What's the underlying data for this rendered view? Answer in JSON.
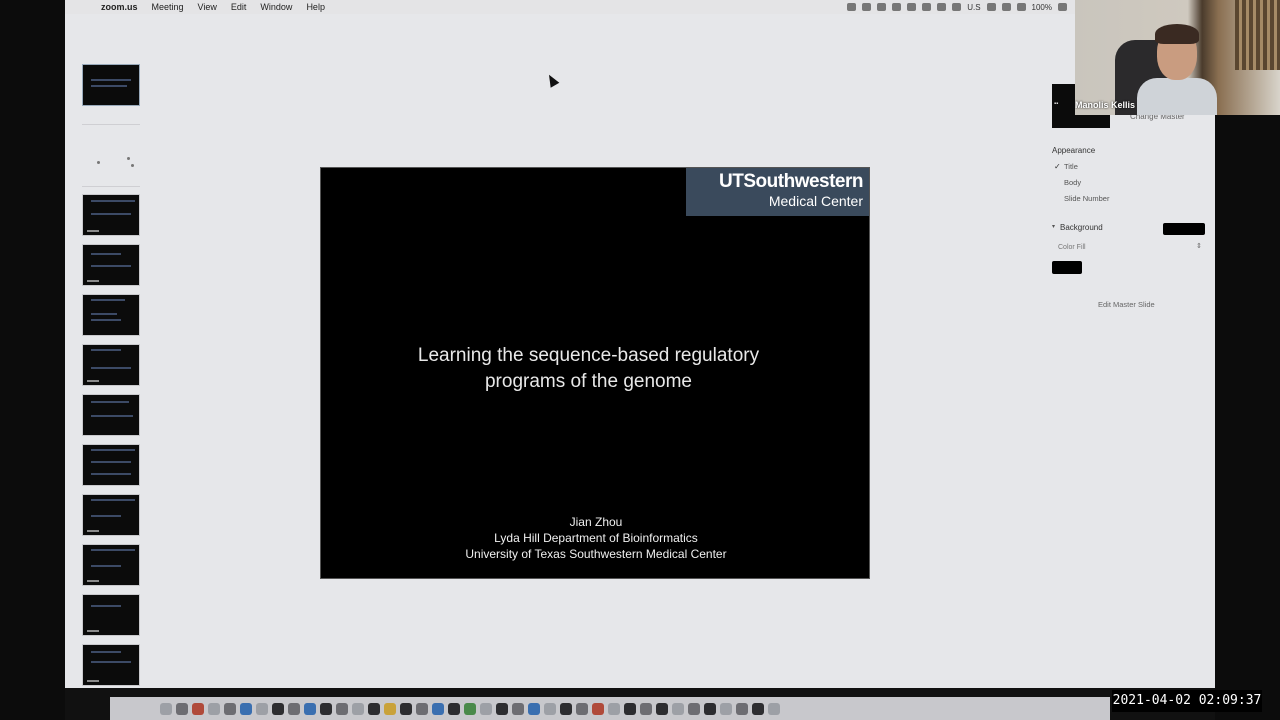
{
  "menubar": {
    "app_name": "zoom.us",
    "menus": [
      "Meeting",
      "View",
      "Edit",
      "Window",
      "Help"
    ],
    "status_right": "U.S",
    "battery": "100%"
  },
  "slide": {
    "logo_line1": "UTSouthwestern",
    "logo_line2": "Medical Center",
    "title_line1": "Learning the sequence-based regulatory",
    "title_line2": "programs of the genome",
    "author": "Jian Zhou",
    "department": "Lyda Hill Department of Bioinformatics",
    "institution": "University of Texas Southwestern Medical Center"
  },
  "panel": {
    "change_master": "Change Master",
    "appearance_heading": "Appearance",
    "options": [
      "Title",
      "Body",
      "Slide Number"
    ],
    "title_checked": "✓",
    "background_label": "Background",
    "color_fill": "Color Fill",
    "edit_master": "Edit Master Slide",
    "background_color": "#000000"
  },
  "video": {
    "participant_name": "Manolis Kellis"
  },
  "timestamp": "2021-04-02 02:09:37",
  "icons": {
    "apple": "apple-icon",
    "cursor": "mouse-pointer-icon"
  }
}
